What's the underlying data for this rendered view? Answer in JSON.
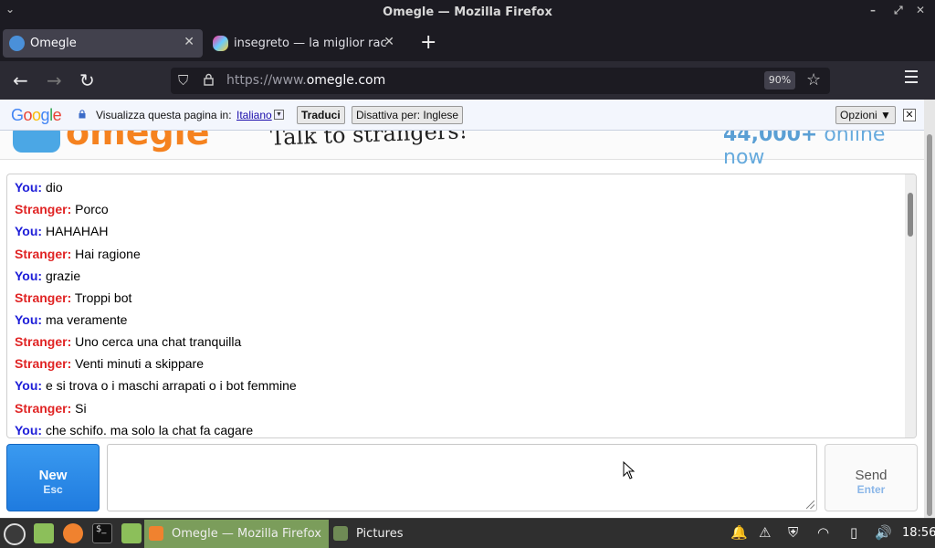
{
  "window": {
    "title": "Omegle — Mozilla Firefox"
  },
  "tabs": [
    {
      "label": "Omegle",
      "active": true
    },
    {
      "label": "insegreto — la miglior raccolta",
      "active": false
    }
  ],
  "urlbar": {
    "prefix": "https://www.",
    "domain": "omegle.com",
    "zoom": "90%"
  },
  "translate_bar": {
    "logo": [
      "G",
      "o",
      "o",
      "g",
      "l",
      "e"
    ],
    "prompt": "Visualizza questa pagina in:",
    "language": "Italiano",
    "translate_button": "Traduci",
    "disable_button": "Disattiva per: Inglese",
    "options_button": "Opzioni ▼",
    "close": "✕"
  },
  "site_header": {
    "logo": "omegle",
    "tagline": "Talk to strangers!",
    "online_count": "44,000+",
    "online_label": "online now"
  },
  "chat": {
    "messages": [
      {
        "who": "You:",
        "text": "dio"
      },
      {
        "who": "Stranger:",
        "text": "Porco"
      },
      {
        "who": "You:",
        "text": "HAHAHAH"
      },
      {
        "who": "Stranger:",
        "text": "Hai ragione"
      },
      {
        "who": "You:",
        "text": "grazie"
      },
      {
        "who": "Stranger:",
        "text": "Troppi bot"
      },
      {
        "who": "You:",
        "text": "ma veramente"
      },
      {
        "who": "Stranger:",
        "text": "Uno cerca una chat tranquilla"
      },
      {
        "who": "Stranger:",
        "text": "Venti minuti a skippare"
      },
      {
        "who": "You:",
        "text": "e si trova o i maschi arrapati o i bot femmine"
      },
      {
        "who": "Stranger:",
        "text": "Si"
      },
      {
        "who": "You:",
        "text": "che schifo. ma solo la chat fa cagare"
      }
    ]
  },
  "controls": {
    "new_label": "New",
    "new_hint": "Esc",
    "send_label": "Send",
    "send_hint": "Enter",
    "message_value": ""
  },
  "taskbar": {
    "windows": [
      {
        "label": "Omegle — Mozilla Firefox",
        "active": true
      },
      {
        "label": "Pictures",
        "active": false
      }
    ],
    "clock": "18:56"
  },
  "colors": {
    "you": "#1d1dd8",
    "stranger": "#e02424",
    "new_button": "#1f7bdf",
    "taskbar_active": "#7b9d5b"
  }
}
